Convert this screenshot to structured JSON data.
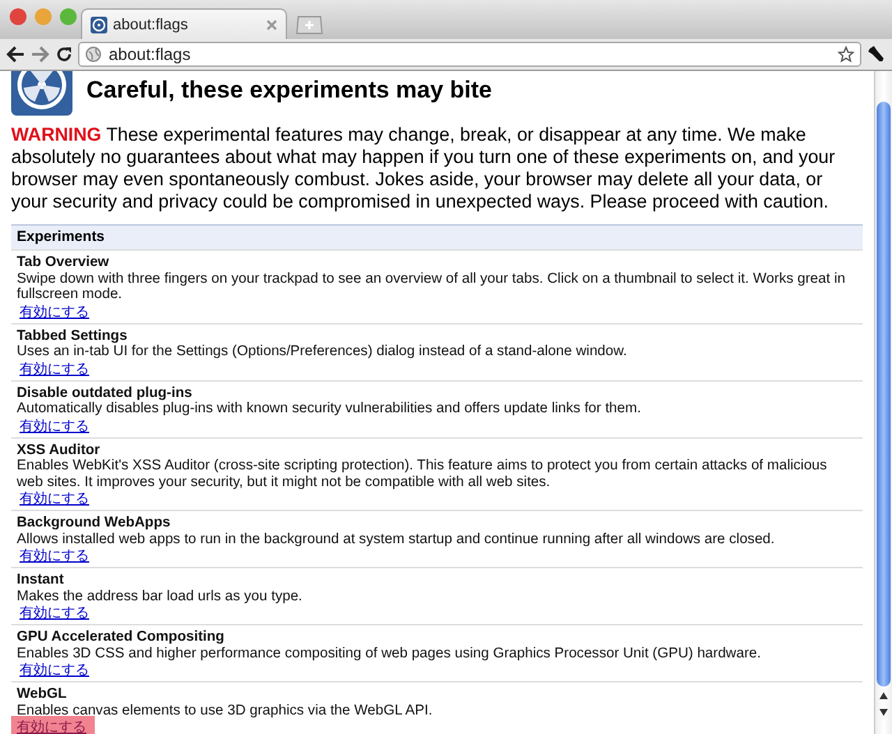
{
  "tab": {
    "title": "about:flags"
  },
  "address": {
    "value": "about:flags"
  },
  "page": {
    "title": "Careful, these experiments may bite",
    "warning": {
      "label": "WARNING",
      "text": "These experimental features may change, break, or disappear at any time. We make absolutely no guarantees about what may happen if you turn one of these experiments on, and your browser may even spontaneously combust. Jokes aside, your browser may delete all your data, or your security and privacy could be compromised in unexpected ways. Please proceed with caution."
    },
    "section_title": "Experiments",
    "experiments": [
      {
        "name": "Tab Overview",
        "description": "Swipe down with three fingers on your trackpad to see an overview of all your tabs. Click on a thumbnail to select it. Works great in fullscreen mode.",
        "link": "有効にする",
        "highlighted": false
      },
      {
        "name": "Tabbed Settings",
        "description": "Uses an in-tab UI for the Settings (Options/Preferences) dialog instead of a stand-alone window.",
        "link": "有効にする",
        "highlighted": false
      },
      {
        "name": "Disable outdated plug-ins",
        "description": "Automatically disables plug-ins with known security vulnerabilities and offers update links for them.",
        "link": "有効にする",
        "highlighted": false
      },
      {
        "name": "XSS Auditor",
        "description": "Enables WebKit's XSS Auditor (cross-site scripting protection). This feature aims to protect you from certain attacks of malicious web sites. It improves your security, but it might not be compatible with all web sites.",
        "link": "有効にする",
        "highlighted": false
      },
      {
        "name": "Background WebApps",
        "description": "Allows installed web apps to run in the background at system startup and continue running after all windows are closed.",
        "link": "有効にする",
        "highlighted": false
      },
      {
        "name": "Instant",
        "description": "Makes the address bar load urls as you type.",
        "link": "有効にする",
        "highlighted": false
      },
      {
        "name": "GPU Accelerated Compositing",
        "description": "Enables 3D CSS and higher performance compositing of web pages using Graphics Processor Unit (GPU) hardware.",
        "link": "有効にする",
        "highlighted": false
      },
      {
        "name": "WebGL",
        "description": "Enables canvas elements to use 3D graphics via the WebGL API.",
        "link": "有効にする",
        "highlighted": true
      }
    ]
  }
}
